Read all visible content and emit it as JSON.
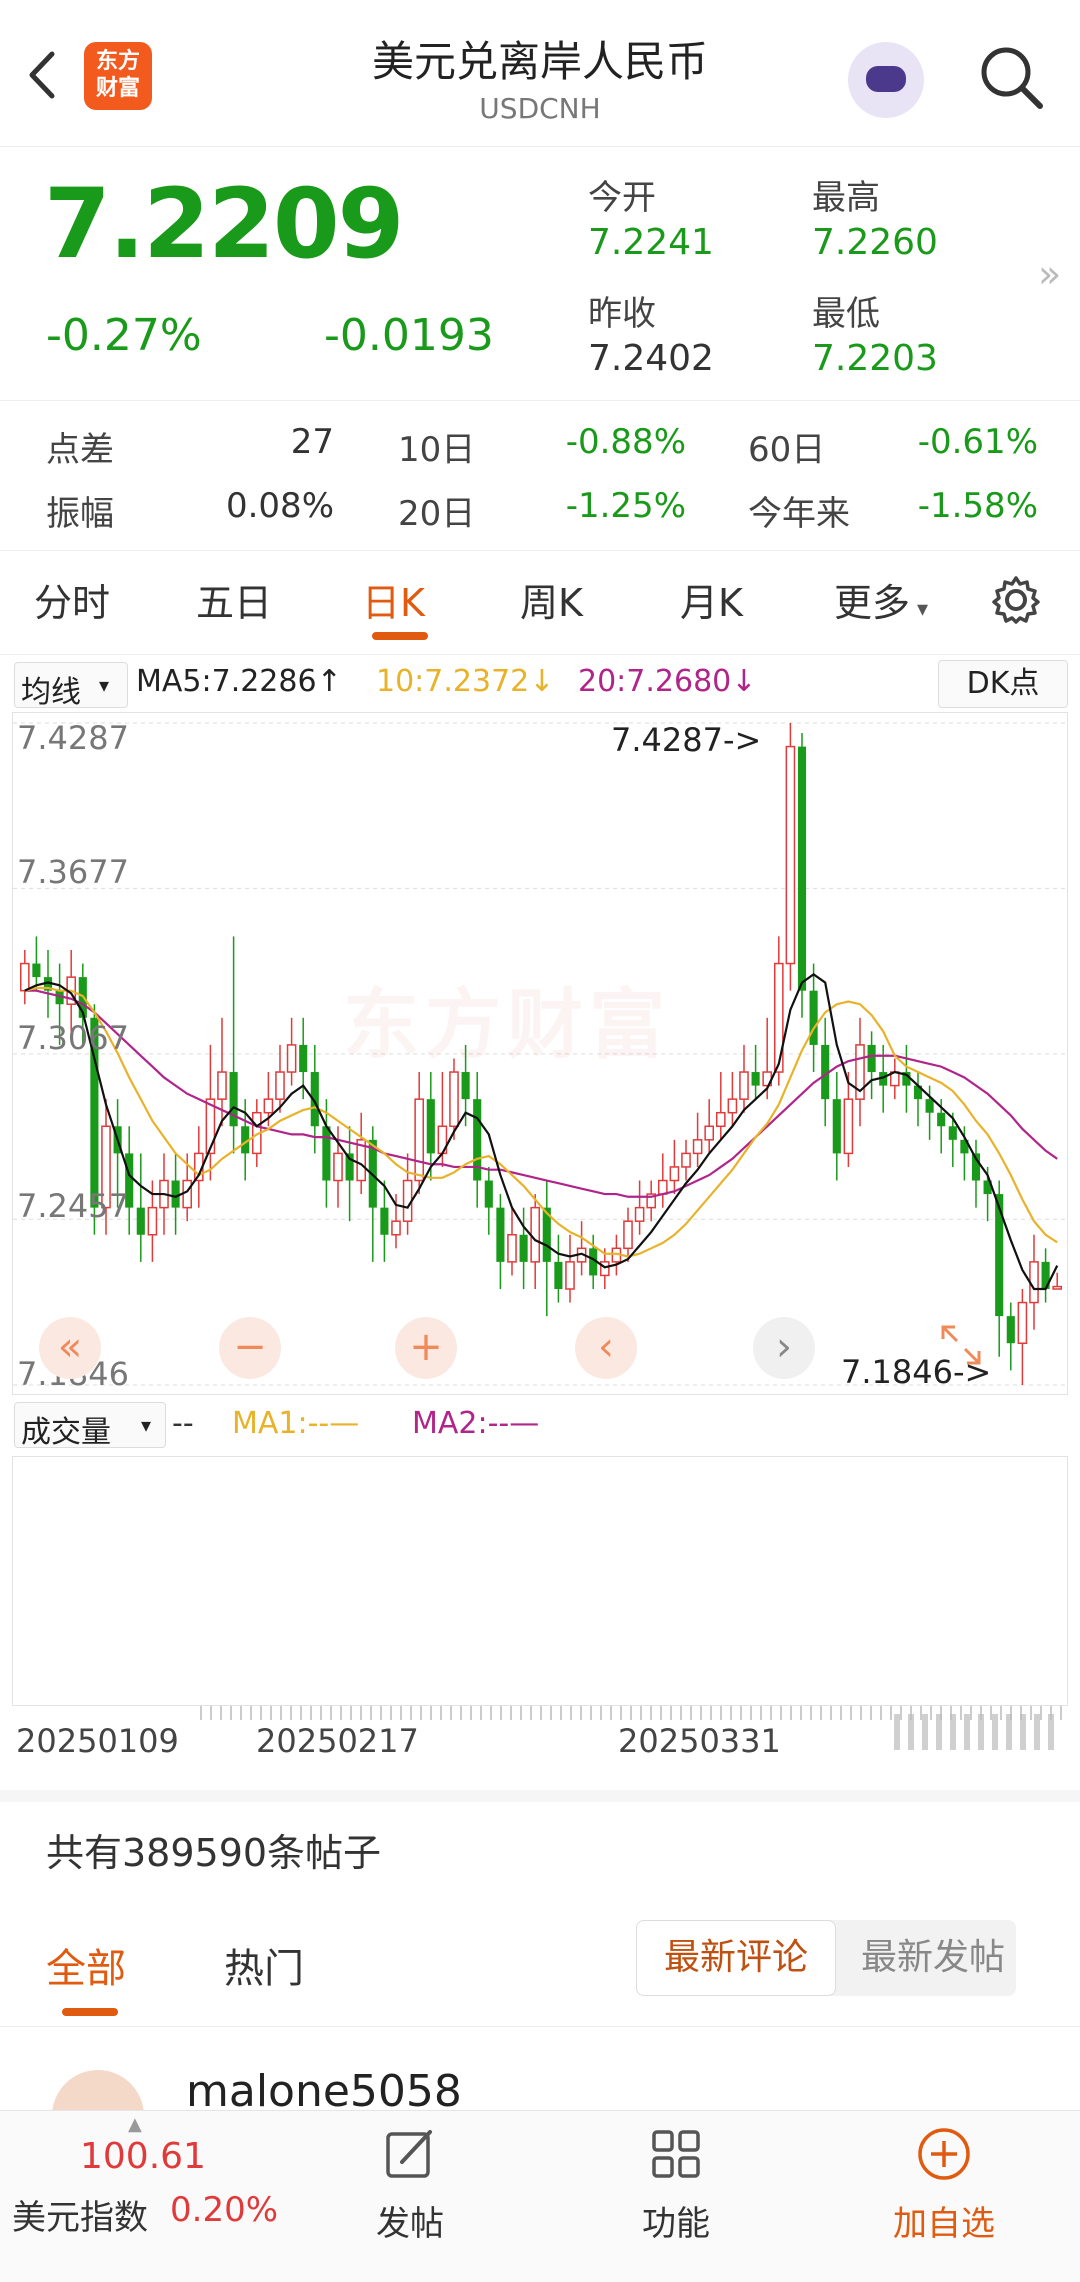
{
  "header": {
    "title": "美元兑离岸人民币",
    "subtitle": "USDCNH",
    "logo_text_line1": "东方",
    "logo_text_line2": "财富"
  },
  "quote": {
    "price": "7.2209",
    "change_pct": "-0.27%",
    "change": "-0.0193",
    "open_label": "今开",
    "open": "7.2241",
    "high_label": "最高",
    "high": "7.2260",
    "prev_close_label": "昨收",
    "prev_close": "7.2402",
    "low_label": "最低",
    "low": "7.2203"
  },
  "stats": {
    "spread_label": "点差",
    "spread": "27",
    "d10_label": "10日",
    "d10": "-0.88%",
    "d60_label": "60日",
    "d60": "-0.61%",
    "amplitude_label": "振幅",
    "amplitude": "0.08%",
    "d20_label": "20日",
    "d20": "-1.25%",
    "ytd_label": "今年来",
    "ytd": "-1.58%"
  },
  "tabs": [
    "分时",
    "五日",
    "日K",
    "周K",
    "月K",
    "更多"
  ],
  "ma_bar": {
    "selector": "均线",
    "ma5": "MA5:7.2286↑",
    "ma10": "10:7.2372↓",
    "ma20": "20:7.2680↓",
    "dk": "DK点"
  },
  "chart_y_labels": [
    "7.4287",
    "7.3677",
    "7.3067",
    "7.2457",
    "7.1846"
  ],
  "chart_annotations": {
    "max": "7.4287->",
    "min": "7.1846->"
  },
  "watermark": "东方财富",
  "nav_buttons": [
    "«",
    "−",
    "+",
    "‹",
    "›"
  ],
  "volume": {
    "selector": "成交量",
    "dash": "--",
    "ma1": "MA1:--—",
    "ma2": "MA2:--—"
  },
  "x_labels": [
    "20250109",
    "20250217",
    "20250331"
  ],
  "posts": {
    "count_text": "共有389590条帖子",
    "tab_all": "全部",
    "tab_hot": "热门",
    "sort_latest_comment": "最新评论",
    "sort_latest_post": "最新发帖",
    "first_user": "malone5058"
  },
  "bottom_bar": {
    "index_value": "100.61",
    "index_label": "美元指数",
    "index_pct": "0.20%",
    "post": "发帖",
    "function": "功能",
    "add_watch": "加自选"
  },
  "colors": {
    "up": "#e03a3a",
    "down": "#1a9a1a",
    "accent": "#e05a10",
    "ma5": "#111111",
    "ma10": "#e8b22a",
    "ma20": "#b0258a"
  },
  "chart_data": {
    "type": "candlestick",
    "y_range": [
      7.1846,
      7.4287
    ],
    "y_ticks": [
      7.4287,
      7.3677,
      7.3067,
      7.2457,
      7.1846
    ],
    "max_label": 7.4287,
    "min_label": 7.1846,
    "candles": [
      [
        7.33,
        7.34,
        7.345,
        7.325
      ],
      [
        7.34,
        7.335,
        7.35,
        7.33
      ],
      [
        7.335,
        7.33,
        7.345,
        7.32
      ],
      [
        7.33,
        7.325,
        7.34,
        7.31
      ],
      [
        7.325,
        7.335,
        7.345,
        7.315
      ],
      [
        7.335,
        7.32,
        7.34,
        7.31
      ],
      [
        7.32,
        7.25,
        7.325,
        7.24
      ],
      [
        7.25,
        7.28,
        7.29,
        7.24
      ],
      [
        7.28,
        7.27,
        7.29,
        7.25
      ],
      [
        7.27,
        7.25,
        7.28,
        7.24
      ],
      [
        7.25,
        7.24,
        7.27,
        7.23
      ],
      [
        7.24,
        7.25,
        7.26,
        7.23
      ],
      [
        7.25,
        7.26,
        7.27,
        7.24
      ],
      [
        7.26,
        7.25,
        7.27,
        7.24
      ],
      [
        7.25,
        7.26,
        7.27,
        7.245
      ],
      [
        7.26,
        7.27,
        7.28,
        7.25
      ],
      [
        7.27,
        7.29,
        7.31,
        7.26
      ],
      [
        7.29,
        7.3,
        7.32,
        7.28
      ],
      [
        7.3,
        7.28,
        7.35,
        7.27
      ],
      [
        7.28,
        7.27,
        7.29,
        7.26
      ],
      [
        7.27,
        7.285,
        7.29,
        7.265
      ],
      [
        7.285,
        7.29,
        7.3,
        7.28
      ],
      [
        7.29,
        7.3,
        7.31,
        7.285
      ],
      [
        7.3,
        7.31,
        7.32,
        7.295
      ],
      [
        7.31,
        7.3,
        7.32,
        7.29
      ],
      [
        7.3,
        7.28,
        7.31,
        7.27
      ],
      [
        7.28,
        7.26,
        7.29,
        7.25
      ],
      [
        7.26,
        7.27,
        7.28,
        7.25
      ],
      [
        7.27,
        7.26,
        7.28,
        7.245
      ],
      [
        7.26,
        7.275,
        7.285,
        7.255
      ],
      [
        7.275,
        7.25,
        7.28,
        7.23
      ],
      [
        7.25,
        7.24,
        7.26,
        7.23
      ],
      [
        7.24,
        7.245,
        7.255,
        7.235
      ],
      [
        7.245,
        7.26,
        7.27,
        7.24
      ],
      [
        7.26,
        7.29,
        7.3,
        7.255
      ],
      [
        7.29,
        7.27,
        7.3,
        7.26
      ],
      [
        7.27,
        7.28,
        7.3,
        7.265
      ],
      [
        7.28,
        7.3,
        7.305,
        7.275
      ],
      [
        7.3,
        7.29,
        7.31,
        7.28
      ],
      [
        7.29,
        7.26,
        7.3,
        7.25
      ],
      [
        7.26,
        7.25,
        7.265,
        7.24
      ],
      [
        7.25,
        7.23,
        7.255,
        7.22
      ],
      [
        7.23,
        7.24,
        7.25,
        7.225
      ],
      [
        7.24,
        7.23,
        7.25,
        7.22
      ],
      [
        7.23,
        7.25,
        7.255,
        7.22
      ],
      [
        7.25,
        7.23,
        7.26,
        7.21
      ],
      [
        7.23,
        7.22,
        7.24,
        7.215
      ],
      [
        7.22,
        7.23,
        7.24,
        7.215
      ],
      [
        7.23,
        7.235,
        7.245,
        7.225
      ],
      [
        7.235,
        7.225,
        7.24,
        7.22
      ],
      [
        7.225,
        7.23,
        7.235,
        7.22
      ],
      [
        7.23,
        7.235,
        7.24,
        7.225
      ],
      [
        7.235,
        7.245,
        7.25,
        7.23
      ],
      [
        7.245,
        7.25,
        7.26,
        7.24
      ],
      [
        7.25,
        7.255,
        7.26,
        7.245
      ],
      [
        7.255,
        7.26,
        7.27,
        7.25
      ],
      [
        7.26,
        7.265,
        7.275,
        7.255
      ],
      [
        7.265,
        7.27,
        7.275,
        7.26
      ],
      [
        7.27,
        7.275,
        7.285,
        7.265
      ],
      [
        7.275,
        7.28,
        7.29,
        7.27
      ],
      [
        7.28,
        7.285,
        7.3,
        7.275
      ],
      [
        7.285,
        7.29,
        7.3,
        7.28
      ],
      [
        7.29,
        7.3,
        7.31,
        7.285
      ],
      [
        7.3,
        7.295,
        7.31,
        7.29
      ],
      [
        7.295,
        7.3,
        7.32,
        7.29
      ],
      [
        7.3,
        7.34,
        7.35,
        7.295
      ],
      [
        7.34,
        7.42,
        7.4287,
        7.33
      ],
      [
        7.42,
        7.33,
        7.425,
        7.32
      ],
      [
        7.33,
        7.31,
        7.34,
        7.3
      ],
      [
        7.31,
        7.29,
        7.32,
        7.28
      ],
      [
        7.29,
        7.27,
        7.3,
        7.26
      ],
      [
        7.27,
        7.29,
        7.3,
        7.265
      ],
      [
        7.29,
        7.31,
        7.32,
        7.28
      ],
      [
        7.31,
        7.3,
        7.315,
        7.29
      ],
      [
        7.3,
        7.295,
        7.31,
        7.285
      ],
      [
        7.295,
        7.3,
        7.305,
        7.29
      ],
      [
        7.3,
        7.295,
        7.31,
        7.285
      ],
      [
        7.295,
        7.29,
        7.3,
        7.28
      ],
      [
        7.29,
        7.285,
        7.295,
        7.275
      ],
      [
        7.285,
        7.28,
        7.29,
        7.27
      ],
      [
        7.28,
        7.275,
        7.285,
        7.265
      ],
      [
        7.275,
        7.27,
        7.28,
        7.26
      ],
      [
        7.27,
        7.26,
        7.275,
        7.25
      ],
      [
        7.26,
        7.255,
        7.265,
        7.245
      ],
      [
        7.255,
        7.21,
        7.26,
        7.195
      ],
      [
        7.21,
        7.2,
        7.215,
        7.19
      ],
      [
        7.2,
        7.215,
        7.22,
        7.1846
      ],
      [
        7.215,
        7.23,
        7.24,
        7.205
      ],
      [
        7.23,
        7.22,
        7.235,
        7.215
      ],
      [
        7.22,
        7.2209,
        7.226,
        7.2203
      ]
    ],
    "ma5": [
      7.33,
      7.332,
      7.333,
      7.332,
      7.329,
      7.322,
      7.305,
      7.288,
      7.275,
      7.262,
      7.258,
      7.255,
      7.255,
      7.254,
      7.256,
      7.262,
      7.272,
      7.282,
      7.287,
      7.285,
      7.28,
      7.283,
      7.287,
      7.292,
      7.295,
      7.289,
      7.28,
      7.274,
      7.268,
      7.266,
      7.262,
      7.258,
      7.251,
      7.25,
      7.257,
      7.265,
      7.27,
      7.278,
      7.285,
      7.283,
      7.277,
      7.262,
      7.25,
      7.243,
      7.238,
      7.236,
      7.233,
      7.232,
      7.233,
      7.231,
      7.228,
      7.229,
      7.231,
      7.236,
      7.241,
      7.247,
      7.253,
      7.259,
      7.264,
      7.27,
      7.275,
      7.28,
      7.286,
      7.29,
      7.294,
      7.303,
      7.323,
      7.333,
      7.336,
      7.333,
      7.31,
      7.296,
      7.293,
      7.297,
      7.298,
      7.3,
      7.299,
      7.295,
      7.291,
      7.287,
      7.283,
      7.276,
      7.268,
      7.262,
      7.25,
      7.238,
      7.227,
      7.22,
      7.22,
      7.2286
    ],
    "ma10": [
      7.33,
      7.331,
      7.331,
      7.33,
      7.33,
      7.328,
      7.322,
      7.315,
      7.307,
      7.298,
      7.29,
      7.282,
      7.276,
      7.27,
      7.266,
      7.262,
      7.264,
      7.268,
      7.271,
      7.274,
      7.277,
      7.279,
      7.282,
      7.284,
      7.286,
      7.287,
      7.285,
      7.282,
      7.279,
      7.276,
      7.273,
      7.27,
      7.266,
      7.263,
      7.262,
      7.261,
      7.261,
      7.263,
      7.266,
      7.268,
      7.269,
      7.266,
      7.262,
      7.258,
      7.253,
      7.248,
      7.244,
      7.241,
      7.239,
      7.236,
      7.233,
      7.233,
      7.232,
      7.233,
      7.235,
      7.237,
      7.24,
      7.244,
      7.249,
      7.254,
      7.259,
      7.264,
      7.27,
      7.276,
      7.281,
      7.288,
      7.298,
      7.308,
      7.316,
      7.322,
      7.325,
      7.326,
      7.325,
      7.321,
      7.315,
      7.306,
      7.302,
      7.3,
      7.298,
      7.296,
      7.293,
      7.288,
      7.282,
      7.277,
      7.27,
      7.262,
      7.253,
      7.245,
      7.24,
      7.2372
    ],
    "ma20": [
      7.33,
      7.33,
      7.329,
      7.328,
      7.327,
      7.325,
      7.322,
      7.318,
      7.314,
      7.31,
      7.306,
      7.302,
      7.298,
      7.295,
      7.292,
      7.29,
      7.288,
      7.286,
      7.284,
      7.282,
      7.28,
      7.279,
      7.278,
      7.277,
      7.277,
      7.276,
      7.276,
      7.275,
      7.274,
      7.273,
      7.272,
      7.27,
      7.269,
      7.268,
      7.267,
      7.266,
      7.266,
      7.265,
      7.265,
      7.265,
      7.264,
      7.264,
      7.263,
      7.262,
      7.261,
      7.26,
      7.259,
      7.258,
      7.257,
      7.256,
      7.255,
      7.255,
      7.254,
      7.254,
      7.254,
      7.255,
      7.256,
      7.258,
      7.26,
      7.262,
      7.265,
      7.268,
      7.272,
      7.276,
      7.28,
      7.284,
      7.288,
      7.292,
      7.296,
      7.299,
      7.302,
      7.304,
      7.305,
      7.306,
      7.306,
      7.306,
      7.305,
      7.304,
      7.303,
      7.302,
      7.3,
      7.298,
      7.295,
      7.292,
      7.288,
      7.284,
      7.279,
      7.275,
      7.271,
      7.268
    ]
  }
}
